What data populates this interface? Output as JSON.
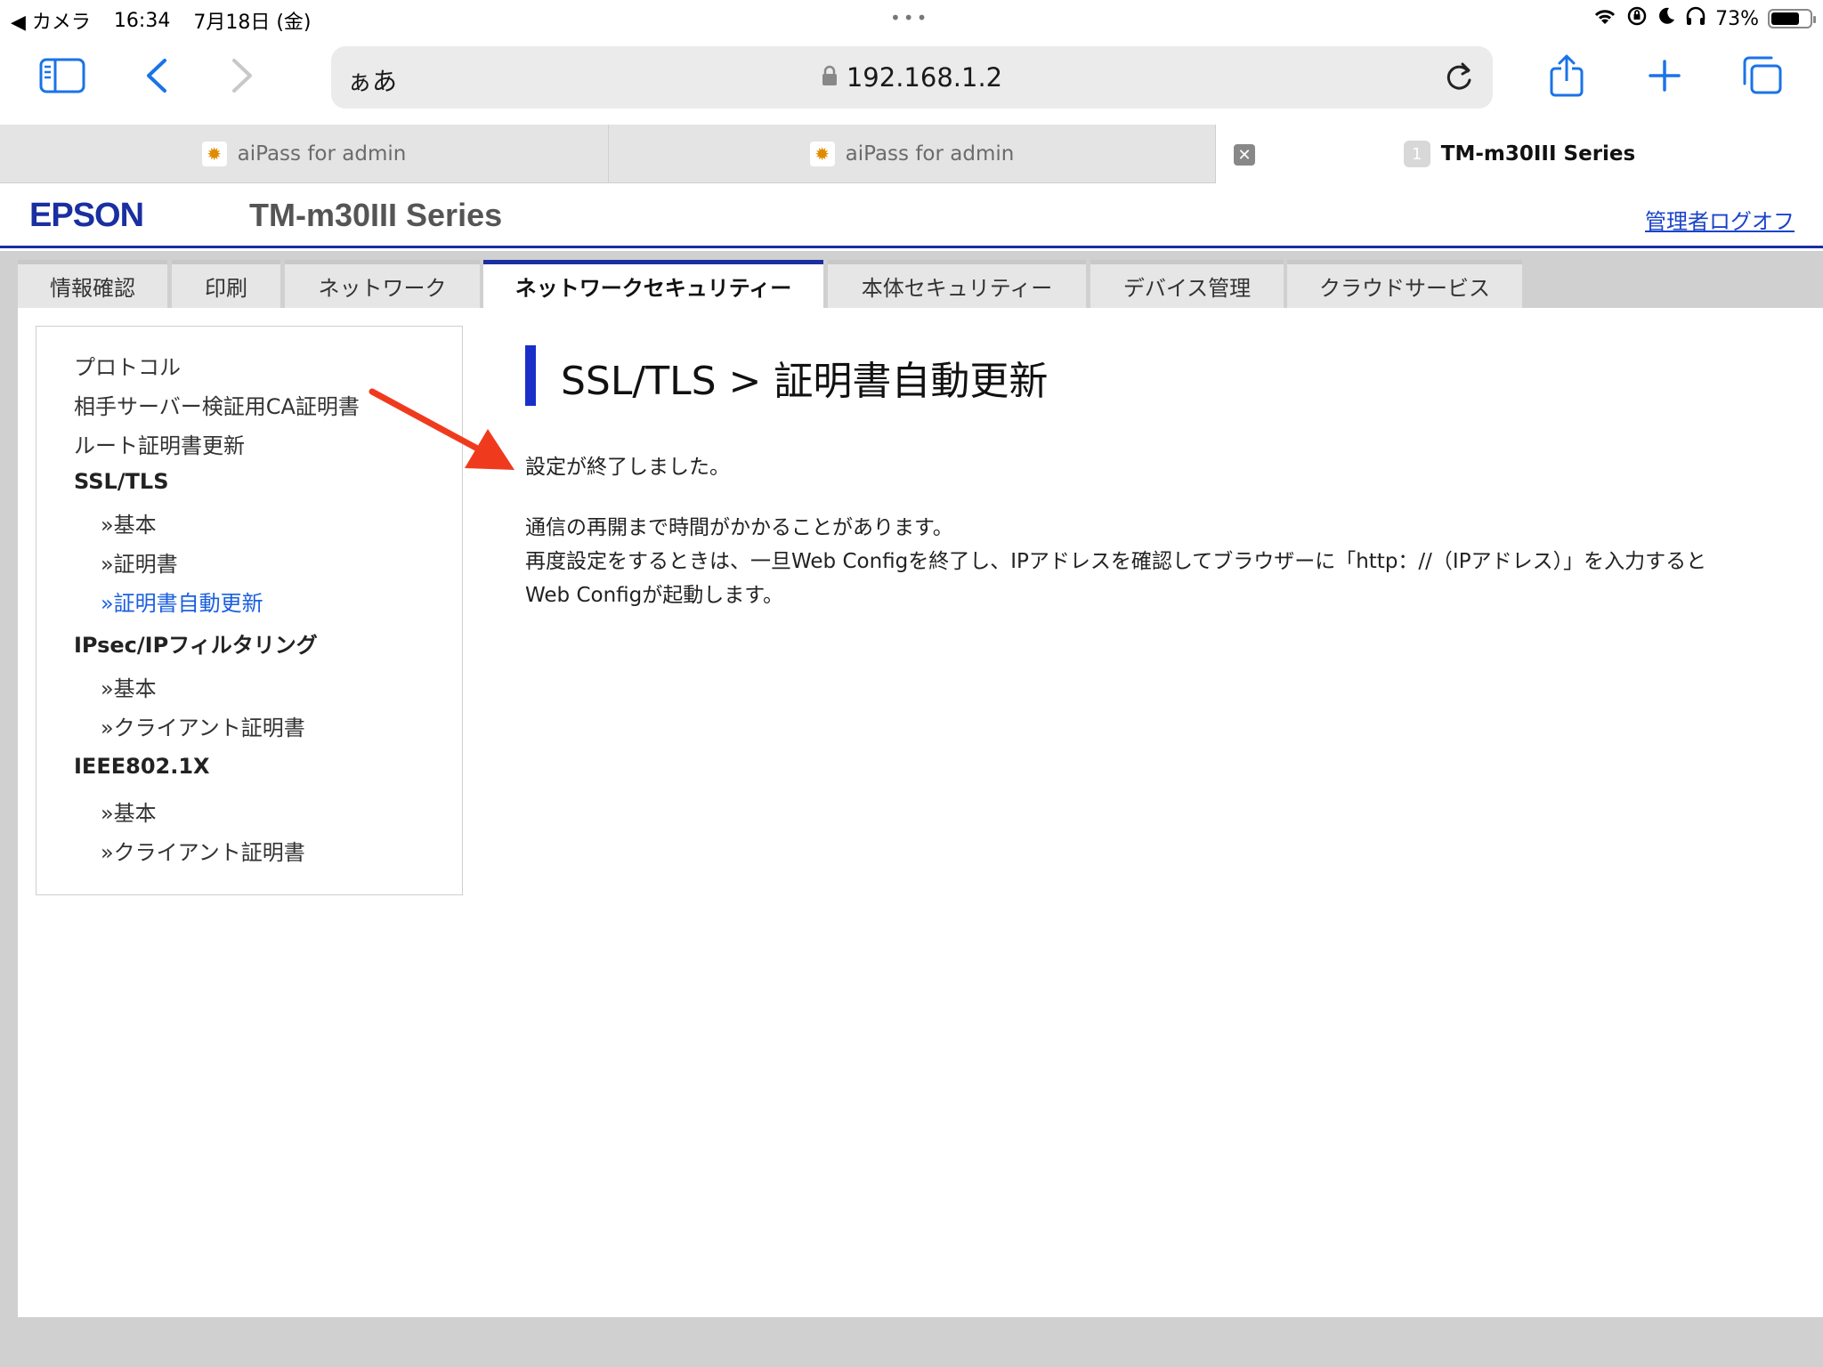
{
  "status_bar": {
    "back_app": "◀ カメラ",
    "time": "16:34",
    "date": "7月18日 (金)",
    "battery": "73%",
    "battery_level": 0.73
  },
  "browser": {
    "text_size_label": "ぁあ",
    "url": "192.168.1.2",
    "tabs": [
      {
        "title": "aiPass for admin"
      },
      {
        "title": "aiPass for admin"
      },
      {
        "title": "TM-m30III Series",
        "badge": "1"
      }
    ]
  },
  "header": {
    "logo": "EPSON",
    "model": "TM-m30III Series",
    "logoff": "管理者ログオフ"
  },
  "nav": {
    "tabs": [
      {
        "label": "情報確認"
      },
      {
        "label": "印刷"
      },
      {
        "label": "ネットワーク"
      },
      {
        "label": "ネットワークセキュリティー"
      },
      {
        "label": "本体セキュリティー"
      },
      {
        "label": "デバイス管理"
      },
      {
        "label": "クラウドサービス"
      }
    ]
  },
  "sidebar": {
    "items": [
      {
        "label": "プロトコル"
      },
      {
        "label": "相手サーバー検証用CA証明書"
      },
      {
        "label": "ルート証明書更新"
      },
      {
        "label": "SSL/TLS"
      },
      {
        "label": "»基本"
      },
      {
        "label": "»証明書"
      },
      {
        "label": "»証明書自動更新"
      },
      {
        "label": "IPsec/IPフィルタリング"
      },
      {
        "label": "»基本"
      },
      {
        "label": "»クライアント証明書"
      },
      {
        "label": "IEEE802.1X"
      },
      {
        "label": "»基本"
      },
      {
        "label": "»クライアント証明書"
      }
    ]
  },
  "main": {
    "heading": "SSL/TLS > 証明書自動更新",
    "message_done": "設定が終了しました。",
    "message_line1": "通信の再開まで時間がかかることがあります。",
    "message_line2": "再度設定をするときは、一旦Web Configを終了し、IPアドレスを確認してブラウザーに「http：//（IPアドレス）」を入力すると",
    "message_line3": "Web Configが起動します。"
  },
  "colors": {
    "epson_blue": "#1a2fa0",
    "link_blue": "#1a44c8",
    "current_item": "#1a5fe0",
    "annotation_arrow": "#f03a1e"
  }
}
